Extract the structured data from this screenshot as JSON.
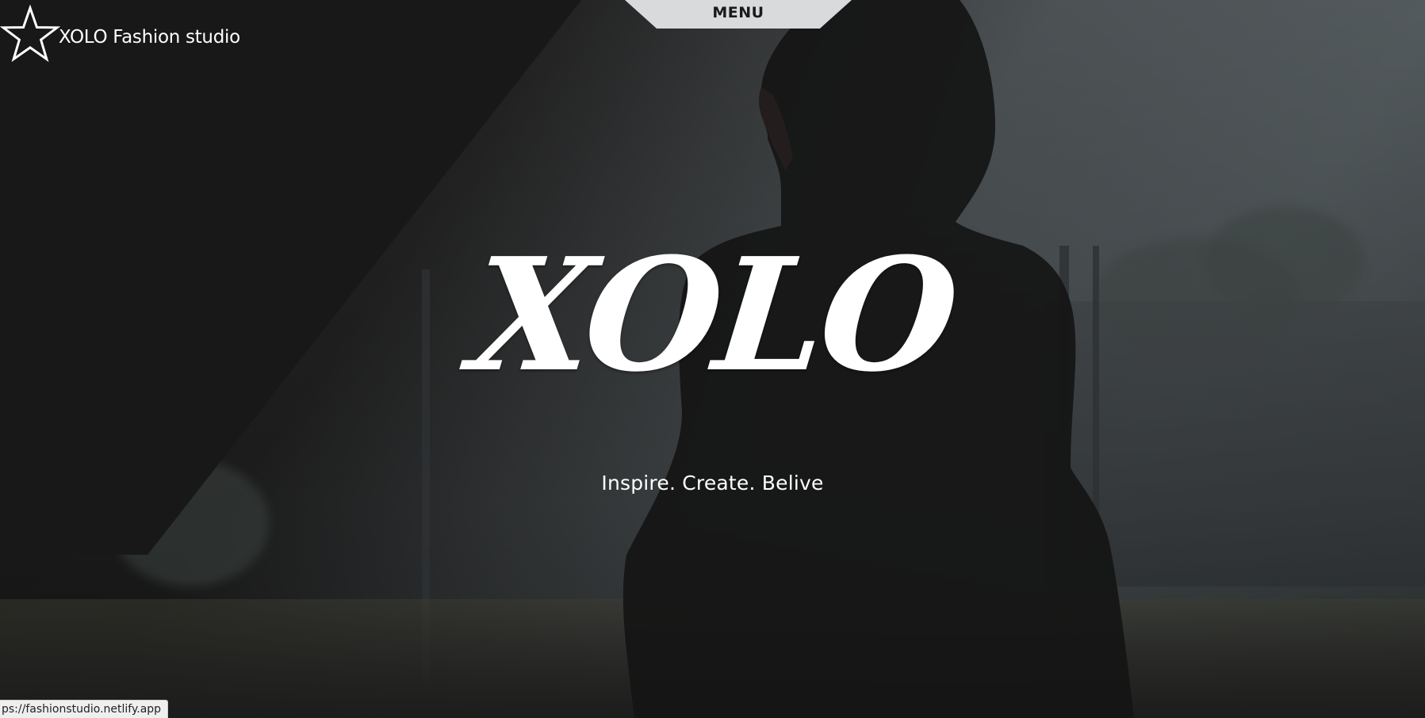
{
  "nav": {
    "menu_label": "MENU"
  },
  "logo": {
    "icon": "star-outline-icon",
    "text": "XOLO Fashion studio"
  },
  "hero": {
    "title": "XOLO",
    "tagline": "Inspire. Create. Belive"
  },
  "status_bar": {
    "url": "ps://fashionstudio.netlify.app"
  },
  "colors": {
    "text": "#ffffff",
    "menu_tab": "#d8dadb",
    "menu_text": "#1a1a1a"
  }
}
